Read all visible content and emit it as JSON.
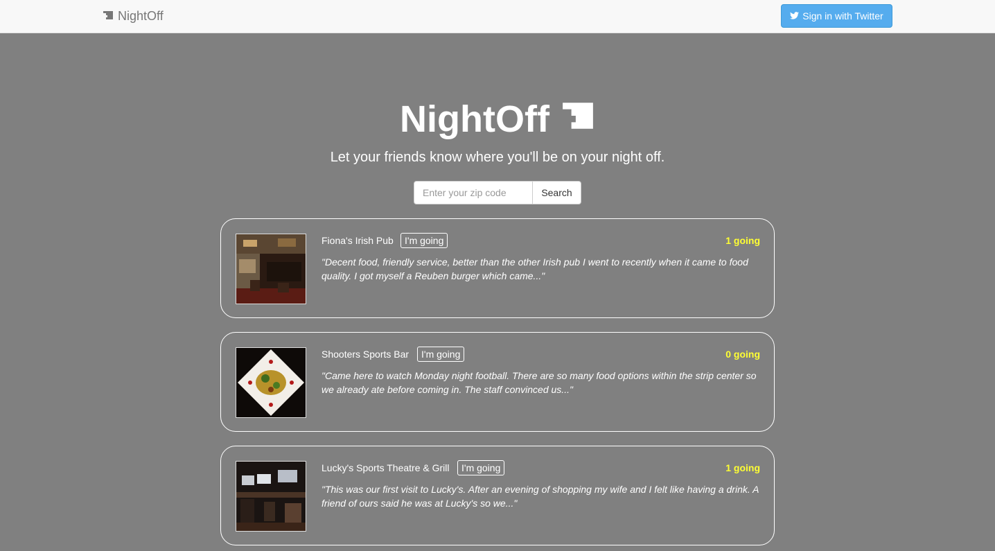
{
  "navbar": {
    "brand": "NightOff",
    "signin_label": "Sign in with Twitter"
  },
  "hero": {
    "title": "NightOff",
    "subtitle": "Let your friends know where you'll be on your night off."
  },
  "search": {
    "placeholder": "Enter your zip code",
    "value": "",
    "button_label": "Search"
  },
  "venues": [
    {
      "name": "Fiona's Irish Pub",
      "going_label": "I'm going",
      "going_count": "1 going",
      "review": "\"Decent food, friendly service, better than the other Irish pub I went to recently when it came to food quality. I got myself a Reuben burger which came...\""
    },
    {
      "name": "Shooters Sports Bar",
      "going_label": "I'm going",
      "going_count": "0 going",
      "review": "\"Came here to watch Monday night football. There are so many food options within the strip center so we already ate before coming in. The staff convinced us...\""
    },
    {
      "name": "Lucky's Sports Theatre & Grill",
      "going_label": "I'm going",
      "going_count": "1 going",
      "review": "\"This was our first visit to Lucky's. After an evening of shopping my wife and I felt like having a drink. A friend of ours said he was at Lucky's so we...\""
    }
  ],
  "colors": {
    "background": "#808080",
    "navbar": "#f8f8f8",
    "twitter": "#55acee",
    "going_count": "#ffff33"
  },
  "icons": {
    "brand": "ticket-icon",
    "signin": "twitter-bird-icon"
  }
}
